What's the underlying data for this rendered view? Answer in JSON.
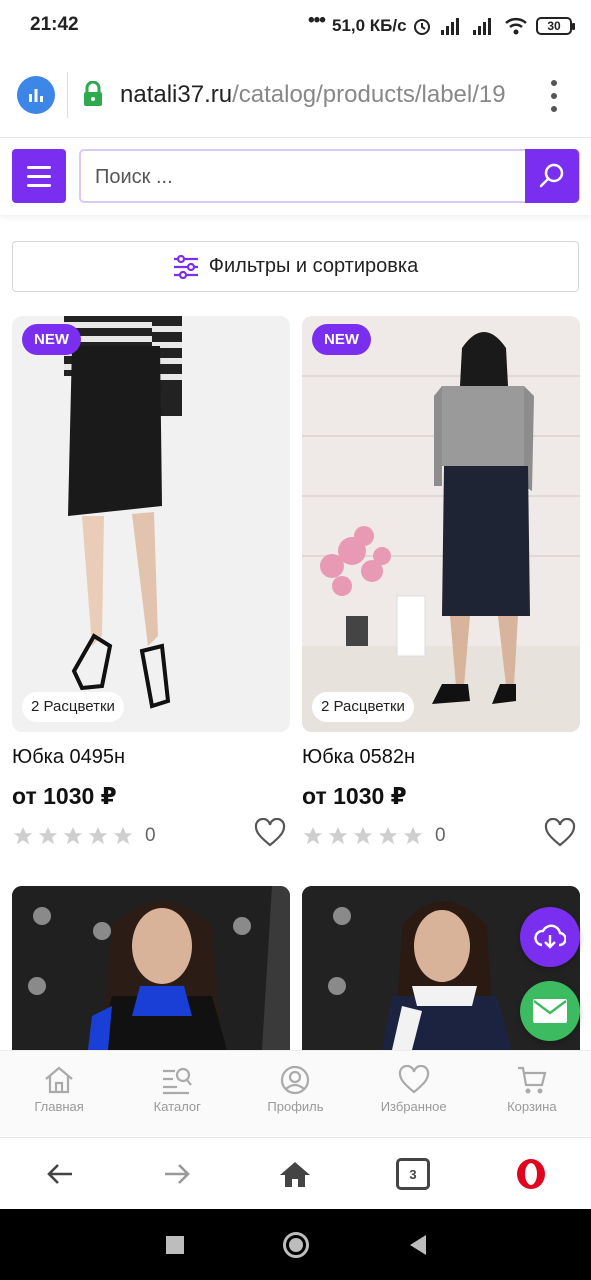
{
  "status_bar": {
    "time": "21:42",
    "network_speed": "51,0 КБ/с",
    "battery": "30"
  },
  "browser": {
    "url_host": "natali37.ru",
    "url_path": "/catalog/products/label/19",
    "tab_count": "3"
  },
  "header": {
    "search_placeholder": "Поиск ..."
  },
  "filters": {
    "label": "Фильтры и сортировка"
  },
  "products": [
    {
      "badge": "NEW",
      "colors": "2 Расцветки",
      "title": "Юбка 0495н",
      "price": "от 1030 ₽",
      "rating_count": "0"
    },
    {
      "badge": "NEW",
      "colors": "2 Расцветки",
      "title": "Юбка 0582н",
      "price": "от 1030 ₽",
      "rating_count": "0"
    }
  ],
  "bottom_nav": {
    "items": [
      {
        "label": "Главная",
        "icon": "home-icon"
      },
      {
        "label": "Каталог",
        "icon": "catalog-search-icon"
      },
      {
        "label": "Профиль",
        "icon": "profile-icon"
      },
      {
        "label": "Избранное",
        "icon": "heart-icon"
      },
      {
        "label": "Корзина",
        "icon": "cart-icon"
      }
    ]
  },
  "colors": {
    "accent": "#7a2ef0",
    "mail_green": "#3dbb61"
  }
}
